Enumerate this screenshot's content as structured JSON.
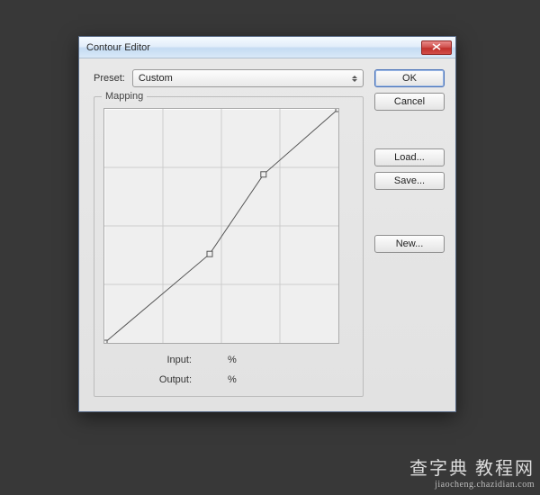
{
  "dialog": {
    "title": "Contour Editor",
    "preset_label": "Preset:",
    "preset_value": "Custom",
    "mapping_label": "Mapping",
    "input_label": "Input:",
    "input_unit": "%",
    "output_label": "Output:",
    "output_unit": "%"
  },
  "buttons": {
    "ok": "OK",
    "cancel": "Cancel",
    "load": "Load...",
    "save": "Save...",
    "new": "New..."
  },
  "chart_data": {
    "type": "line",
    "title": "",
    "xlabel": "Input",
    "ylabel": "Output",
    "xlim": [
      0,
      100
    ],
    "ylim": [
      0,
      100
    ],
    "grid": true,
    "x": [
      0,
      45,
      68,
      100
    ],
    "y": [
      0,
      38,
      72,
      100
    ]
  },
  "watermark": {
    "brand": "查字典 教程网",
    "url": "jiaocheng.chazidian.com"
  }
}
